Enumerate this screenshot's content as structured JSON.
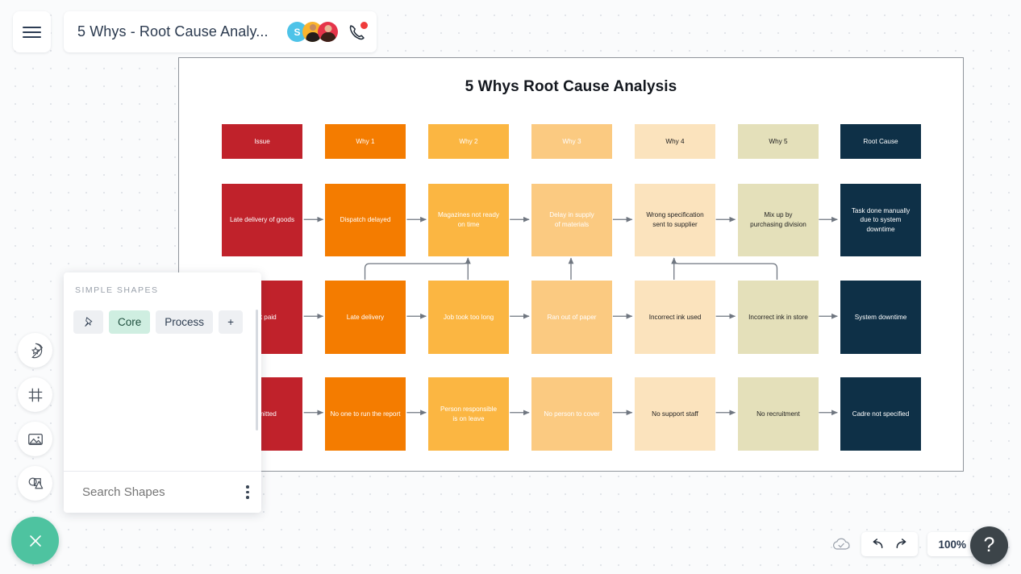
{
  "topbar": {
    "menu_icon": "hamburger-icon",
    "doc_title": "5 Whys - Root Cause Analy...",
    "avatars": [
      {
        "name": "avatar-s",
        "initial": "S",
        "color": "#4ec3e8"
      },
      {
        "name": "avatar-user-2",
        "initial": "",
        "color": "#f9b42d"
      },
      {
        "name": "avatar-user-3",
        "initial": "",
        "color": "#e5344a"
      }
    ],
    "call_icon": "phone-call-icon"
  },
  "canvas": {
    "title": "5 Whys Root Cause Analysis"
  },
  "chart_data": {
    "type": "diagram",
    "title": "5 Whys Root Cause Analysis",
    "columns": [
      "Issue",
      "Why 1",
      "Why 2",
      "Why 3",
      "Why 4",
      "Why 5",
      "Root Cause"
    ],
    "column_colors": [
      "#c0222b",
      "#f47c00",
      "#fbb642",
      "#fbca81",
      "#fbe3bd",
      "#e4e0ba",
      "#0e3047"
    ],
    "header_row": [
      {
        "label": "Issue",
        "color": "#c0222b",
        "text_color": "#ffffff"
      },
      {
        "label": "Why 1",
        "color": "#f47c00",
        "text_color": "#ffffff"
      },
      {
        "label": "Why 2",
        "color": "#fbb642",
        "text_color": "#ffffff"
      },
      {
        "label": "Why 3",
        "color": "#fbca81",
        "text_color": "#ffffff"
      },
      {
        "label": "Why 4",
        "color": "#fbe3bd",
        "text_color": "#222222"
      },
      {
        "label": "Why 5",
        "color": "#e4e0ba",
        "text_color": "#222222"
      },
      {
        "label": "Root Cause",
        "color": "#0e3047",
        "text_color": "#ffffff"
      }
    ],
    "rows": [
      {
        "name": "row-late-delivery",
        "cells": [
          "Late delivery of goods",
          "Dispatch delayed",
          "Magazines not ready\non time",
          "Delay in supply\nof materials",
          "Wrong specification\nsent to supplier",
          "Mix up by\npurchasing division",
          "Task done manually\ndue to system\ndowntime"
        ]
      },
      {
        "name": "row-not-paid",
        "cells": [
          "s not paid",
          "Late delivery",
          "Job took too long",
          "Ran out of paper",
          "Incorrect ink used",
          "Incorrect ink in store",
          "System downtime"
        ]
      },
      {
        "name": "row-submitted",
        "cells": [
          "submitted",
          "No one to run the report",
          "Person responsible\nis on leave",
          "No person to cover",
          "No support staff",
          "No recruitment",
          "Cadre not specified"
        ]
      }
    ]
  },
  "left_toolbar": [
    {
      "name": "sticker-icon",
      "label": "Stickers"
    },
    {
      "name": "frame-icon",
      "label": "Frames"
    },
    {
      "name": "image-icon",
      "label": "Images"
    },
    {
      "name": "shapes-icon",
      "label": "Shapes"
    }
  ],
  "shapes_panel": {
    "heading": "SIMPLE SHAPES",
    "shapes": [
      {
        "name": "circle-shape"
      },
      {
        "name": "arc-shape"
      },
      {
        "name": "square-shape"
      },
      {
        "name": "ellipse-shape"
      },
      {
        "name": "table-lines-shape"
      },
      {
        "name": "rectangle-shape"
      },
      {
        "name": "rounded-rectangle-shape"
      },
      {
        "name": "triangle-shape"
      },
      {
        "name": "right-triangle-shape"
      },
      {
        "name": "diamond-shape"
      },
      {
        "name": "pentagon-shape"
      },
      {
        "name": "hexagon-shape"
      },
      {
        "name": "heptagon-shape"
      },
      {
        "name": "octagon-shape"
      },
      {
        "name": "nonagon-shape"
      },
      {
        "name": "decagon-shape"
      },
      {
        "name": "trapezoid-shape"
      },
      {
        "name": "parallelogram-shape"
      },
      {
        "name": "grid-table-shape"
      }
    ],
    "categories": [
      {
        "name": "pin-icon",
        "label": ""
      },
      {
        "name": "category-core",
        "label": "Core",
        "active": true
      },
      {
        "name": "category-process",
        "label": "Process",
        "active": false
      },
      {
        "name": "add-category",
        "label": "+",
        "active": false
      }
    ],
    "search_placeholder": "Search Shapes",
    "kebab_icon": "more-options-icon"
  },
  "bottom": {
    "close_label": "close-icon",
    "cloud_status_icon": "cloud-saved-icon",
    "undo_icon": "undo-icon",
    "redo_icon": "redo-icon",
    "zoom_level": "100%",
    "keyboard_icon": "keyboard-icon",
    "help_label": "?"
  }
}
